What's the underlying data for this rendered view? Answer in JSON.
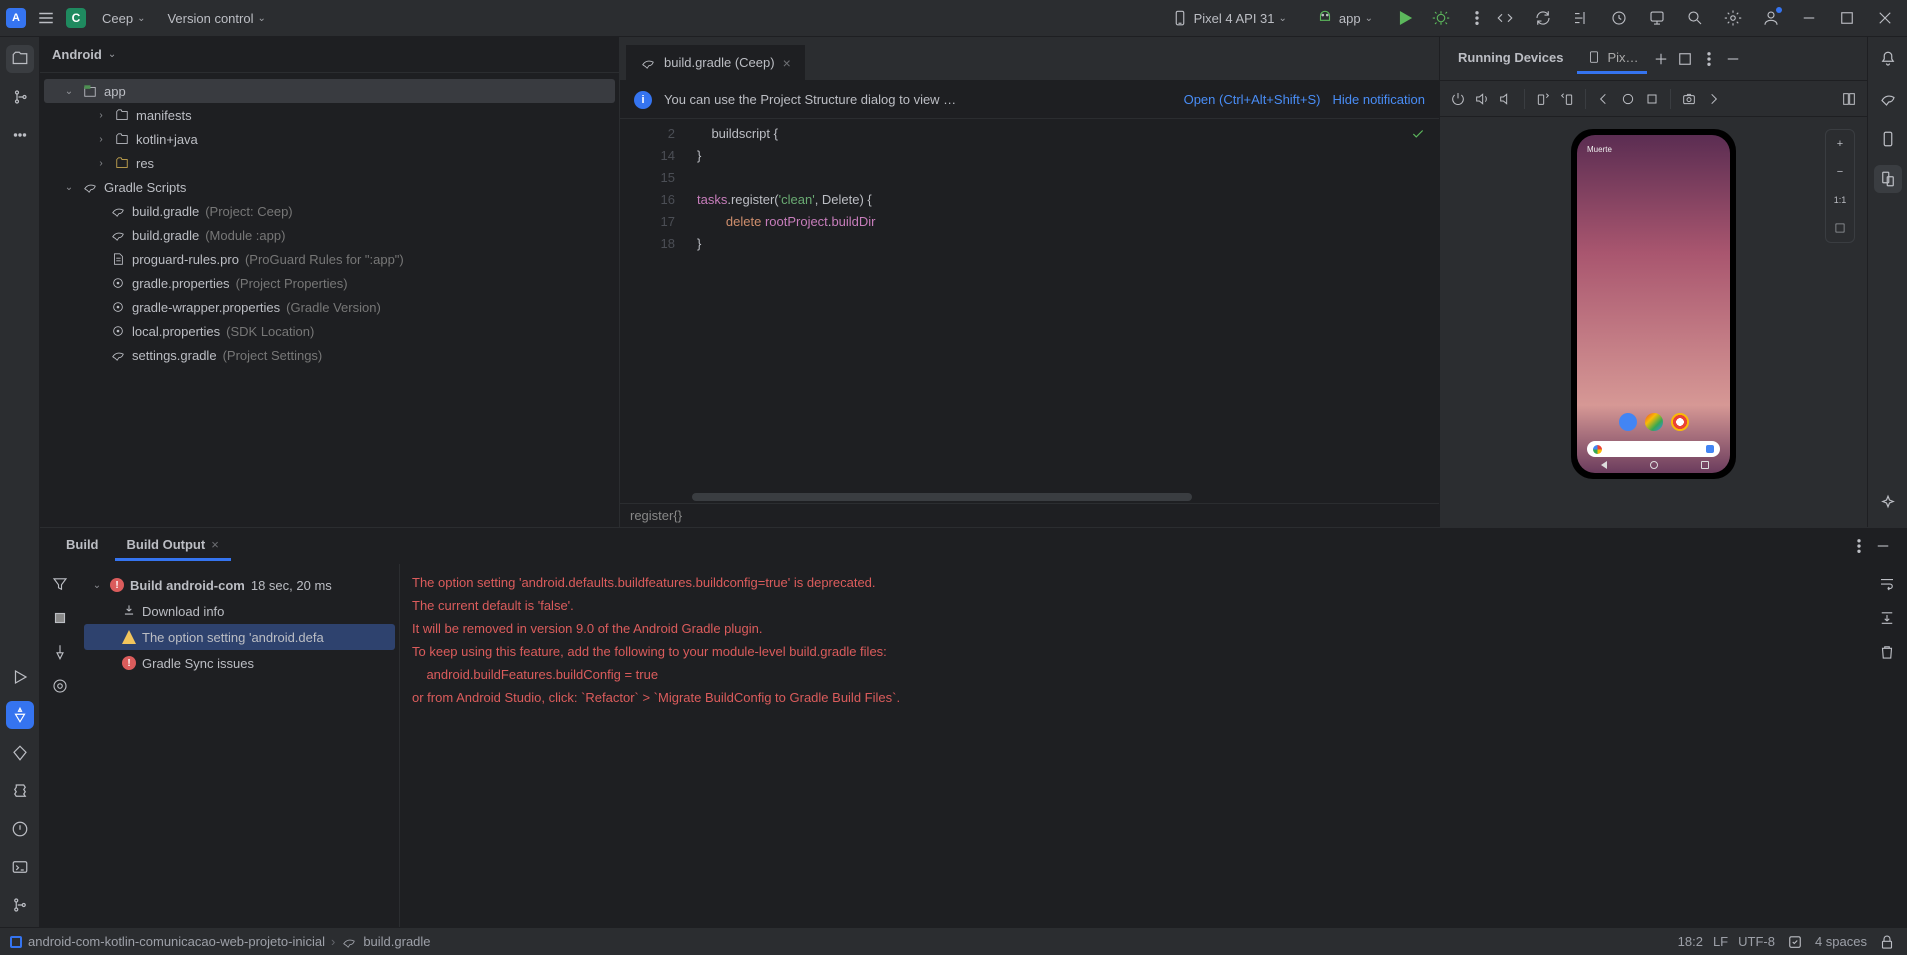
{
  "titlebar": {
    "logo_initial": "A",
    "project_badge": "C",
    "project_name": "Ceep",
    "vcs_label": "Version control",
    "device_label": "Pixel 4 API 31",
    "run_config": "app"
  },
  "project_pane": {
    "mode": "Android",
    "tree": {
      "app": "app",
      "manifests": "manifests",
      "kotlin_java": "kotlin+java",
      "res": "res",
      "gradle_scripts": "Gradle Scripts",
      "bg_project": "build.gradle",
      "bg_project_hint": "(Project: Ceep)",
      "bg_module": "build.gradle",
      "bg_module_hint": "(Module :app)",
      "proguard": "proguard-rules.pro",
      "proguard_hint": "(ProGuard Rules for \":app\")",
      "gp": "gradle.properties",
      "gp_hint": "(Project Properties)",
      "gwp": "gradle-wrapper.properties",
      "gwp_hint": "(Gradle Version)",
      "lp": "local.properties",
      "lp_hint": "(SDK Location)",
      "sg": "settings.gradle",
      "sg_hint": "(Project Settings)"
    }
  },
  "editor": {
    "tab_label": "build.gradle (Ceep)",
    "notification": {
      "message": "You can use the Project Structure dialog to view …",
      "open_label": "Open (Ctrl+Alt+Shift+S)",
      "hide_label": "Hide notification"
    },
    "gutter": [
      "2",
      "14",
      "15",
      "16",
      "17",
      "18"
    ],
    "code_lines": {
      "l2": "    buildscript {",
      "l14": "}",
      "l15": "",
      "l16_a": "tasks",
      "l16_b": ".register(",
      "l16_c": "'clean'",
      "l16_d": ", Delete) {",
      "l17_a": "        delete ",
      "l17_b": "rootProject",
      "l17_c": ".",
      "l17_d": "buildDir",
      "l18": "}"
    },
    "breadcrumb": "register{}"
  },
  "running_devices": {
    "title": "Running Devices",
    "tab_short": "Pix…",
    "phone_status": "Muerte"
  },
  "build_panel": {
    "tab_build": "Build",
    "tab_output": "Build Output",
    "tree": {
      "root": "Build android-com",
      "root_time": "18 sec, 20 ms",
      "download": "Download info",
      "warn": "The option setting 'android.defa",
      "err": "Gradle Sync issues"
    },
    "output_lines": [
      "The option setting 'android.defaults.buildfeatures.buildconfig=true' is deprecated.",
      "The current default is 'false'.",
      "It will be removed in version 9.0 of the Android Gradle plugin.",
      "To keep using this feature, add the following to your module-level build.gradle files:",
      "    android.buildFeatures.buildConfig = true",
      "or from Android Studio, click: `Refactor` > `Migrate BuildConfig to Gradle Build Files`."
    ]
  },
  "statusbar": {
    "crumb_project": "android-com-kotlin-comunicacao-web-projeto-inicial",
    "crumb_file": "build.gradle",
    "pos": "18:2",
    "line_sep": "LF",
    "encoding": "UTF-8",
    "indent": "4 spaces"
  }
}
